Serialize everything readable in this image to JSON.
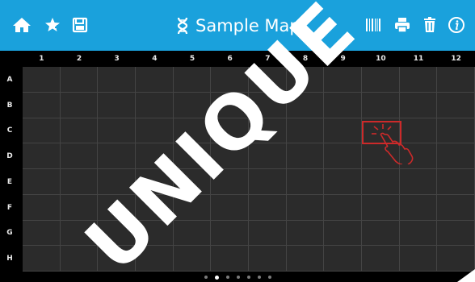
{
  "header": {
    "title": "Sample Map",
    "left_icons": [
      "home-icon",
      "favorites-icon",
      "save-icon"
    ],
    "right_icons": [
      "barcode-icon",
      "print-icon",
      "delete-icon",
      "info-icon"
    ]
  },
  "grid": {
    "columns": [
      "1",
      "2",
      "3",
      "4",
      "5",
      "6",
      "7",
      "8",
      "9",
      "10",
      "11",
      "12"
    ],
    "rows": [
      "A",
      "B",
      "C",
      "D",
      "E",
      "F",
      "G",
      "H"
    ],
    "tap_hint_cell": "C10"
  },
  "pager": {
    "pages": 7,
    "current": 2
  },
  "colors": {
    "header": "#1aa1dc",
    "grid_bg": "#2b2b2b",
    "highlight": "#cc2a2a",
    "watermark": "#ffffff"
  }
}
